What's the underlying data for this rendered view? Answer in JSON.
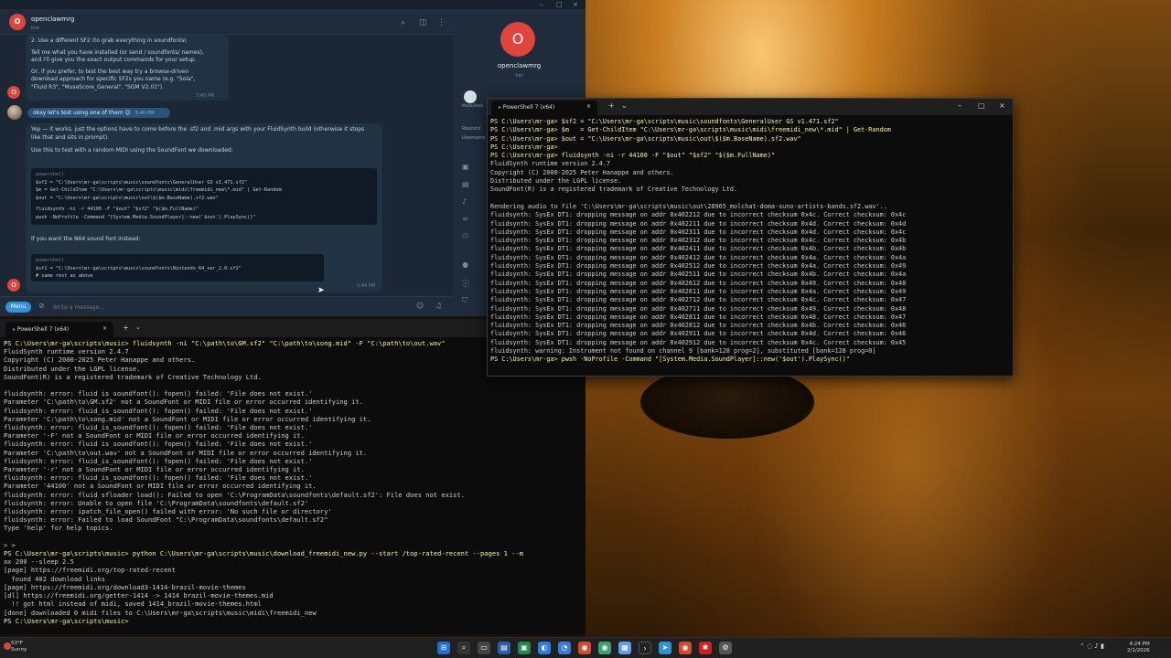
{
  "chat": {
    "contact_name": "openclawmrg",
    "contact_status": "bot",
    "avatar_letter": "O",
    "messages": {
      "m1_line1": "2. Use a different SF2 (to grab everything in soundfonts\\",
      "m1_line2": "Tell me what you have installed (or send / soundfonts/ names),",
      "m1_line3": "and I'll give you the exact output commands for your setup.",
      "m1_line4": "Or, if you prefer, to test the best way try a browse-driven",
      "m1_line5": "download approach for specific SF2s you name (e.g. \"Sola\",",
      "m1_line6": "\"Fluid R3\", \"MuseScore_General\", \"SGM V2.01\").",
      "m1_time": "5:40 PM",
      "out_text": "okay let's test using one of them 😊",
      "out_time": "5:40 PM",
      "m2_line1": "Yep — it works, just the options have to come before the .sf2 and .mid args with your FluidSynth build (otherwise it stops",
      "m2_line2": "like that and sits in prompt).",
      "m2_line3": "Use this to test with a random MIDI using the SoundFont we downloaded:",
      "code1_lang": "powershell",
      "code1_l1": "$sf2 = \"C:\\Users\\mr-ga\\scripts\\music\\soundfonts\\GeneralUser GS v1.471.sf2\"",
      "code1_l2": "$m   = Get-ChildItem \"C:\\Users\\mr-ga\\scripts\\music\\midi\\freemidi_new\\*.mid\" | Get-Random",
      "code1_l3": "$out = \"C:\\Users\\mr-ga\\scripts\\music\\out\\$($m.BaseName).sf2.wav\"",
      "code1_l4": "fluidsynth -ni -r 44100 -F \"$out\" \"$sf2\" \"$($m.FullName)\"",
      "code1_l5": "pwsh -NoProfile -Command \"[System.Media.SoundPlayer]::new('$out').PlaySync()\"",
      "m3_line1": "If you want the N64 sound font instead:",
      "code2_lang": "powershell",
      "code2_l1": "$sf2 = \"C:\\Users\\mr-ga\\scripts\\music\\soundfonts\\Nintendo_64_ver_2.0.sf2\"",
      "code2_l2": "# same rest as above",
      "m3_time": "5:44 PM"
    },
    "menu_label": "Menu",
    "compose_placeholder": "Write a message..."
  },
  "profile": {
    "name": "openclawmrg",
    "status": "bot",
    "partial_label_1": "Mute/Unm",
    "partial_label_2": "Roocord",
    "partial_label_3": "Username"
  },
  "ps_floating": {
    "tab_title": "PowerShell 7 (x64)",
    "lines": [
      "PS C:\\Users\\mr-ga> $sf2 = \"C:\\Users\\mr-ga\\scripts\\music\\soundfonts\\GeneralUser GS v1.471.sf2\"",
      "PS C:\\Users\\mr-ga> $m   = Get-ChildItem \"C:\\Users\\mr-ga\\scripts\\music\\midi\\freemidi_new\\*.mid\" | Get-Random",
      "PS C:\\Users\\mr-ga> $out = \"C:\\Users\\mr-ga\\scripts\\music\\out\\$($m.BaseName).sf2.wav\"",
      "PS C:\\Users\\mr-ga>",
      "PS C:\\Users\\mr-ga> fluidsynth -ni -r 44100 -F \"$out\" \"$sf2\" \"$($m.FullName)\"",
      "FluidSynth runtime version 2.4.7",
      "Copyright (C) 2000-2025 Peter Hanappe and others.",
      "Distributed under the LGPL license.",
      "SoundFont(R) is a registered trademark of Creative Technology Ltd.",
      "",
      "Rendering audio to file 'C:\\Users\\mr-ga\\scripts\\music\\out\\28965_molchat-doma-suno-artists-bands.sf2.wav'..",
      "fluidsynth: SysEx DT1: dropping message on addr 0x402212 due to incorrect checksum 0x4c. Correct checksum: 0x4c",
      "fluidsynth: SysEx DT1: dropping message on addr 0x402211 due to incorrect checksum 0x4d. Correct checksum: 0x4d",
      "fluidsynth: SysEx DT1: dropping message on addr 0x402311 due to incorrect checksum 0x4d. Correct checksum: 0x4c",
      "fluidsynth: SysEx DT1: dropping message on addr 0x402312 due to incorrect checksum 0x4c. Correct checksum: 0x4b",
      "fluidsynth: SysEx DT1: dropping message on addr 0x402411 due to incorrect checksum 0x4b. Correct checksum: 0x4b",
      "fluidsynth: SysEx DT1: dropping message on addr 0x402412 due to incorrect checksum 0x4a. Correct checksum: 0x4a",
      "fluidsynth: SysEx DT1: dropping message on addr 0x402512 due to incorrect checksum 0x4a. Correct checksum: 0x49",
      "fluidsynth: SysEx DT1: dropping message on addr 0x402511 due to incorrect checksum 0x4b. Correct checksum: 0x4a",
      "fluidsynth: SysEx DT1: dropping message on addr 0x402612 due to incorrect checksum 0x49. Correct checksum: 0x48",
      "fluidsynth: SysEx DT1: dropping message on addr 0x402611 due to incorrect checksum 0x4a. Correct checksum: 0x49",
      "fluidsynth: SysEx DT1: dropping message on addr 0x402712 due to incorrect checksum 0x4c. Correct checksum: 0x47",
      "fluidsynth: SysEx DT1: dropping message on addr 0x402711 due to incorrect checksum 0x49. Correct checksum: 0x48",
      "fluidsynth: SysEx DT1: dropping message on addr 0x402811 due to incorrect checksum 0x48. Correct checksum: 0x47",
      "fluidsynth: SysEx DT1: dropping message on addr 0x402812 due to incorrect checksum 0x4b. Correct checksum: 0x46",
      "fluidsynth: SysEx DT1: dropping message on addr 0x402911 due to incorrect checksum 0x4d. Correct checksum: 0x46",
      "fluidsynth: SysEx DT1: dropping message on addr 0x402912 due to incorrect checksum 0x4c. Correct checksum: 0x45",
      "fluidsynth: warning: Instrument not found on channel 9 [bank=128 prog=2], substituted [bank=128 prog=0]",
      "PS C:\\Users\\mr-ga> pwsh -NoProfile -Command \"[System.Media.SoundPlayer]::new('$out').PlaySync()\""
    ]
  },
  "ps_docked": {
    "tab_title": "PowerShell 7 (x64)",
    "lines": [
      "PS C:\\Users\\mr-ga\\scripts\\music> fluidsynth -ni \"C:\\path\\to\\GM.sf2\" \"C:\\path\\to\\song.mid\" -F \"C:\\path\\to\\out.wav\"",
      "FluidSynth runtime version 2.4.7",
      "Copyright (C) 2000-2025 Peter Hanappe and others.",
      "Distributed under the LGPL license.",
      "SoundFont(R) is a registered trademark of Creative Technology Ltd.",
      "",
      "fluidsynth: error: fluid is soundfont(): fopen() failed: 'File does not exist.'",
      "Parameter 'C:\\path\\to\\GM.sf2' not a SoundFont or MIDI file or error occurred identifying it.",
      "fluidsynth: error: fluid_is_soundfont(): fopen() failed: 'File does not exist.'",
      "Parameter 'C:\\path\\to\\song.mid' not a SoundFont or MIDI file or error occurred identifying it.",
      "fluidsynth: error: fluid_is_soundfont(): fopen() failed: 'File does not exist.'",
      "Parameter '-F' not a SoundFont or MIDI file or error occurred identifying it.",
      "fluidsynth: error: fluid is soundfont(): fopen() failed: 'File does not exist.'",
      "Parameter 'C:\\path\\to\\out.wav' not a SoundFont or MIDI file or error occurred identifying it.",
      "fluidsynth: error: fluid_is_soundfont(): fopen() failed: 'File does not exist.'",
      "Parameter '-r' not a SoundFont or MIDI file or error occurred identifying it.",
      "fluidsynth: error: fluid_is_soundfont(): fopen() failed: 'File does not exist.'",
      "Parameter '44100' not a SoundFont or MIDI file or error occurred identifying it.",
      "fluidsynth: error: fluid sfloader load(): Failed to open 'C:\\ProgramData\\soundfonts\\default.sf2': File does not exist.",
      "fluidsynth: error: Unable to open file 'C:\\ProgramData\\soundfonts\\default.sf2'",
      "fluidsynth: error: ipatch_file_open() failed with error: 'No such file or directory'",
      "fluidsynth: error: Failed to load SoundFont \"C:\\ProgramData\\soundfonts\\default.sf2\"",
      "Type 'help' for help topics.",
      "",
      "> >",
      "PS C:\\Users\\mr-ga\\scripts\\music> python C:\\Users\\mr-ga\\scripts\\music\\download_freemidi_new.py --start /top-rated-recent --pages 1 --m",
      "ax 200 --sleep 2.5",
      "[page] https://freemidi.org/top-rated-recent",
      "  found 402 download links",
      "[page] https://freemidi.org/download3-1414-brazil-movie-themes",
      "[dl] https://freemidi.org/getter-1414 -> 1414 brazil-movie-themes.mid",
      "  !! got html instead of midi, saved 1414_brazil-movie-themes.html",
      "[done] downloaded 0 midi files to C:\\Users\\mr-ga\\scripts\\music\\midi\\freemidi_new",
      "PS C:\\Users\\mr-ga\\scripts\\music>"
    ]
  },
  "taskbar": {
    "weather_temp": "53°F",
    "weather_text": "Sunny",
    "time": "4:24 PM",
    "date": "2/1/2026"
  }
}
